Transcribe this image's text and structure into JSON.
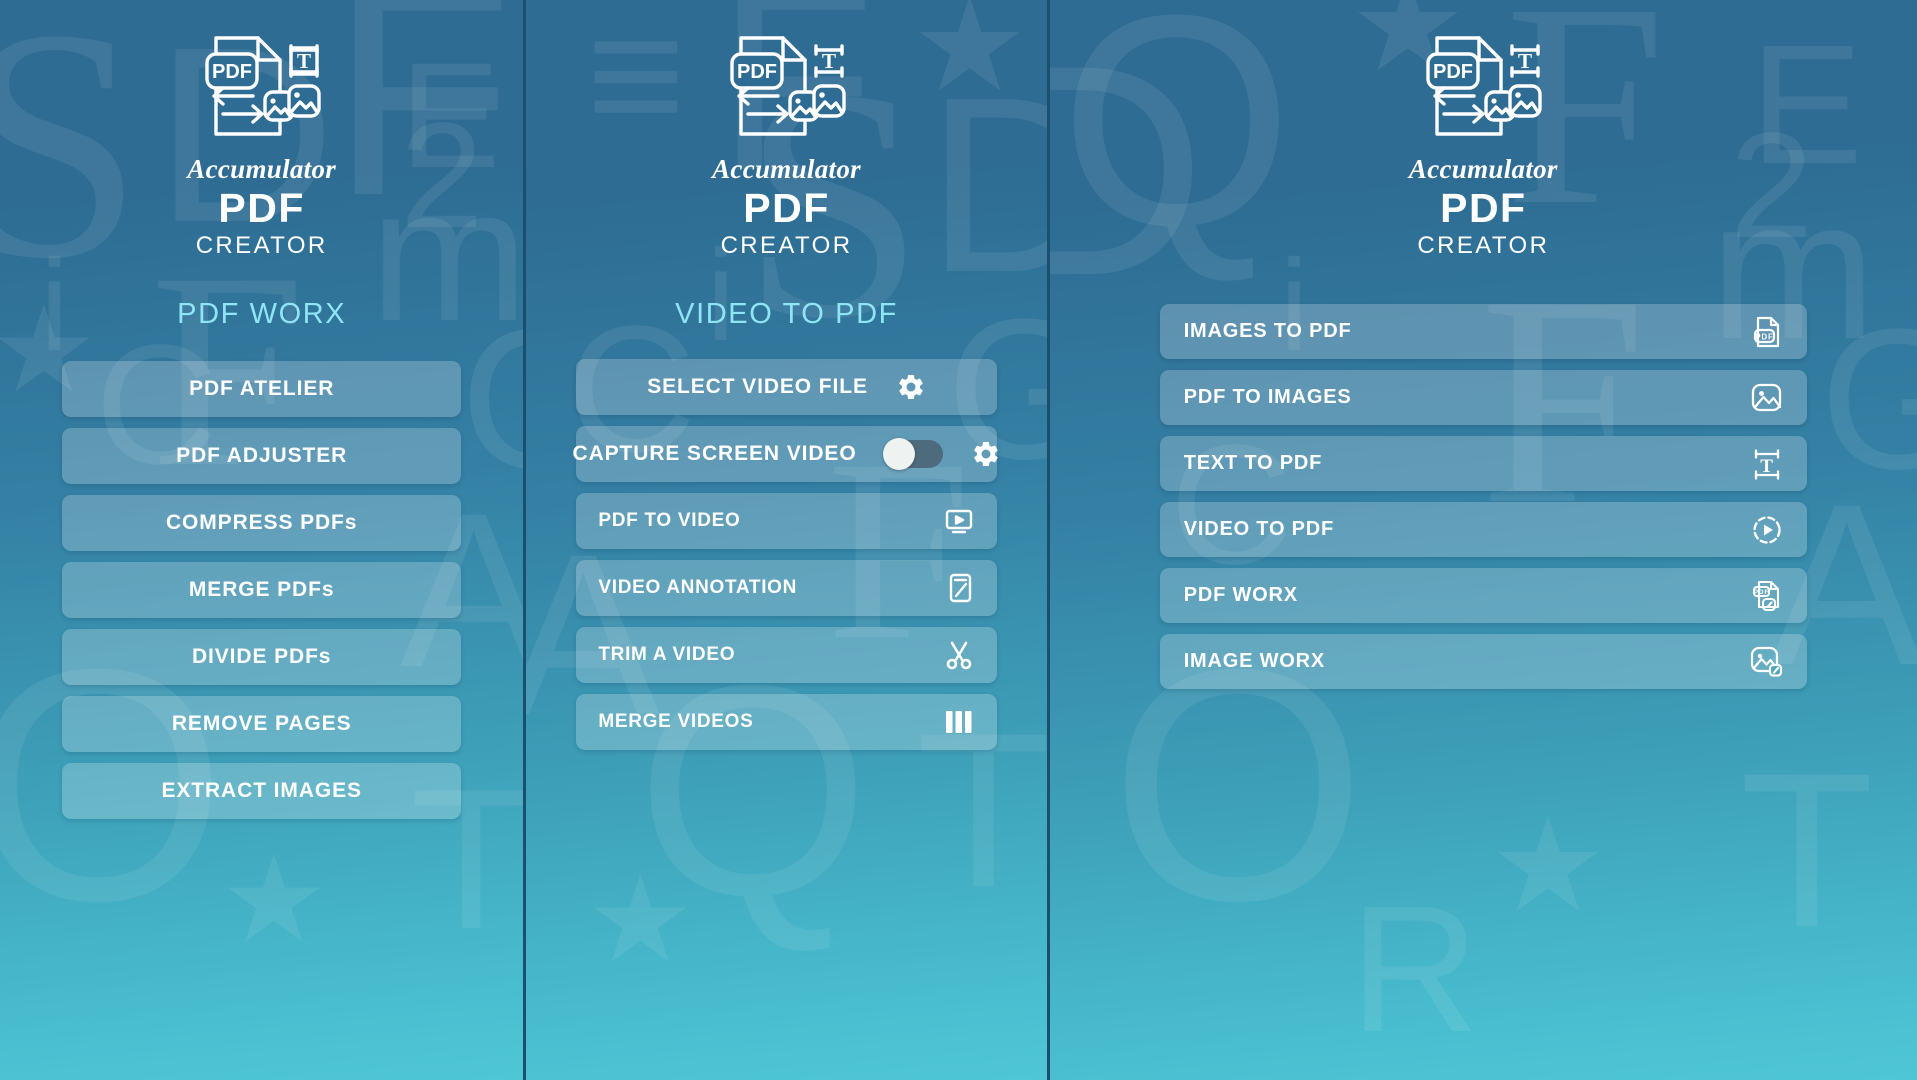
{
  "app": {
    "brand_script": "Accumulator",
    "brand_main": "PDF",
    "brand_sub": "CREATOR",
    "logo_icon": "pdf-document-convert-icon",
    "accent_color": "#8fe4f5",
    "panel_gradient_top": "#2e6c93",
    "panel_gradient_bottom": "#4fc6d6",
    "button_fill": "rgba(255,255,255,0.22)"
  },
  "background_letters": [
    "S",
    "D",
    "F",
    "E",
    "2",
    "m",
    "i",
    "Q",
    "A",
    "O",
    "T",
    "G",
    "C",
    "P",
    "F",
    "R"
  ],
  "panels": [
    {
      "id": "pdf-worx",
      "section_title": "PDF WORX",
      "buttons": [
        {
          "label": "PDF ATELIER",
          "icon": null
        },
        {
          "label": "PDF ADJUSTER",
          "icon": null
        },
        {
          "label": "COMPRESS PDFs",
          "icon": null
        },
        {
          "label": "MERGE PDFs",
          "icon": null
        },
        {
          "label": "DIVIDE PDFs",
          "icon": null
        },
        {
          "label": "REMOVE PAGES",
          "icon": null
        },
        {
          "label": "EXTRACT IMAGES",
          "icon": null
        }
      ]
    },
    {
      "id": "video-to-pdf",
      "section_title": "VIDEO TO PDF",
      "buttons": [
        {
          "label": "SELECT VIDEO FILE",
          "icon": "gear-icon",
          "layout": "center"
        },
        {
          "label": "CAPTURE SCREEN VIDEO",
          "icon": "gear-icon",
          "layout": "center",
          "toggle": "off"
        },
        {
          "label": "PDF TO VIDEO",
          "icon": "video-play-icon",
          "layout": "rowed"
        },
        {
          "label": "VIDEO ANNOTATION",
          "icon": "annotate-icon",
          "layout": "rowed"
        },
        {
          "label": "TRIM A VIDEO",
          "icon": "scissors-icon",
          "layout": "rowed"
        },
        {
          "label": "MERGE VIDEOS",
          "icon": "merge-bars-icon",
          "layout": "rowed"
        }
      ]
    },
    {
      "id": "home-menu",
      "section_title": "",
      "buttons": [
        {
          "label": "IMAGES TO PDF",
          "icon": "pdf-file-icon"
        },
        {
          "label": "PDF TO IMAGES",
          "icon": "image-icon"
        },
        {
          "label": "TEXT TO PDF",
          "icon": "text-frame-icon"
        },
        {
          "label": "VIDEO TO PDF",
          "icon": "play-circle-icon"
        },
        {
          "label": "PDF WORX",
          "icon": "pdf-edit-icon"
        },
        {
          "label": "IMAGE WORX",
          "icon": "image-edit-icon"
        }
      ]
    }
  ]
}
